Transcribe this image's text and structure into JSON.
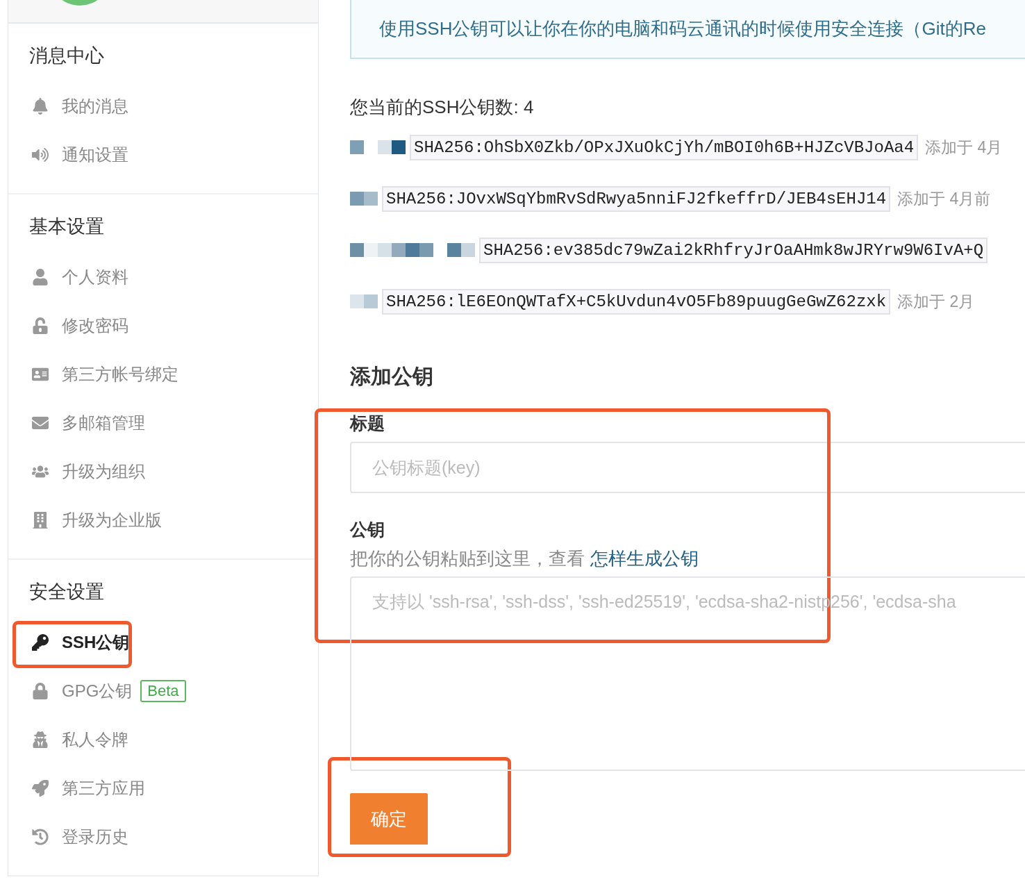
{
  "sidebar": {
    "sections": [
      {
        "title": "消息中心",
        "items": [
          {
            "kind": "bell",
            "label": "我的消息",
            "selected": false
          },
          {
            "kind": "speaker",
            "label": "通知设置",
            "selected": false
          }
        ]
      },
      {
        "title": "基本设置",
        "items": [
          {
            "kind": "user",
            "label": "个人资料",
            "selected": false
          },
          {
            "kind": "unlock",
            "label": "修改密码",
            "selected": false
          },
          {
            "kind": "card",
            "label": "第三方帐号绑定",
            "selected": false
          },
          {
            "kind": "envelope",
            "label": "多邮箱管理",
            "selected": false
          },
          {
            "kind": "users",
            "label": "升级为组织",
            "selected": false
          },
          {
            "kind": "building",
            "label": "升级为企业版",
            "selected": false
          }
        ]
      },
      {
        "title": "安全设置",
        "items": [
          {
            "kind": "key",
            "label": "SSH公钥",
            "selected": true
          },
          {
            "kind": "lock",
            "label": "GPG公钥",
            "badge": "Beta",
            "selected": false
          },
          {
            "kind": "spy",
            "label": "私人令牌",
            "selected": false
          },
          {
            "kind": "rocket",
            "label": "第三方应用",
            "selected": false
          },
          {
            "kind": "history",
            "label": "登录历史",
            "selected": false
          }
        ]
      }
    ]
  },
  "main": {
    "notice": "使用SSH公钥可以让你在你的电脑和码云通讯的时候使用安全连接（Git的Re",
    "key_count": "您当前的SSH公钥数: 4",
    "keys": [
      {
        "fingerprint": "SHA256:OhSbX0Zkb/OPxJXuOkCjYh/mBOI0h6B+HJZcVBJoAa4",
        "added": "添加于 4月"
      },
      {
        "fingerprint": "SHA256:JOvxWSqYbmRvSdRwya5nniFJ2fkeffrD/JEB4sEHJ14",
        "added": "添加于 4月前"
      },
      {
        "fingerprint": "SHA256:ev385dc79wZai2kRhfryJrOaAHmk8wJRYrw9W6IvA+Q"
      },
      {
        "fingerprint": "SHA256:lE6EOnQWTafX+C5kUvdun4vO5Fb89puugGeGwZ62zxk",
        "added": "添加于 2月"
      }
    ],
    "form": {
      "heading": "添加公钥",
      "title_label": "标题",
      "title_placeholder": "公钥标题(key)",
      "key_label": "公钥",
      "hint": "把你的公钥粘贴到这里，查看",
      "hint_link": "怎样生成公钥",
      "key_placeholder": "支持以 'ssh-rsa', 'ssh-dss', 'ssh-ed25519', 'ecdsa-sha2-nistp256', 'ecdsa-sha",
      "submit": "确定"
    }
  }
}
